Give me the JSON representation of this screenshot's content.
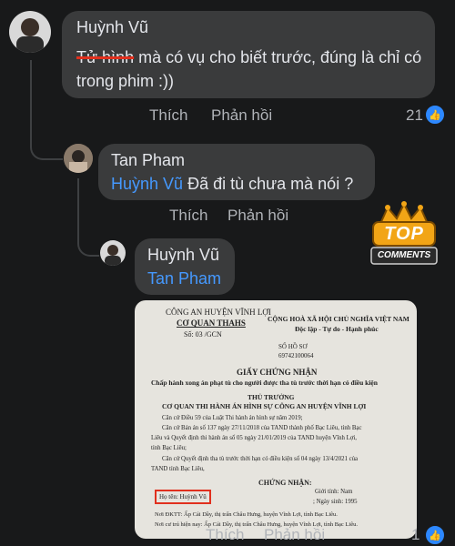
{
  "comments": [
    {
      "author": "Huỳnh Vũ",
      "text_struck": "Tử hình",
      "text_rest": " mà có vụ cho biết trước, đúng là chỉ có trong phim :))",
      "like_label": "Thích",
      "reply_label": "Phản hồi",
      "reaction_count": "21"
    },
    {
      "author": "Tan Pham",
      "mention": "Huỳnh Vũ",
      "text": " Đã đi tù chưa mà nói ?",
      "like_label": "Thích",
      "reply_label": "Phản hồi"
    },
    {
      "author": "Huỳnh Vũ",
      "mention": "Tan Pham",
      "like_label": "Thích",
      "reply_label": "Phản hồi",
      "reaction_count": "1"
    }
  ],
  "watermark": {
    "line1": "TOP",
    "line2": "COMMENTS"
  },
  "document": {
    "left_header_1": "CÔNG AN HUYỆN VĨNH LỢI",
    "left_header_2": "CƠ QUAN THAHS",
    "number": "Số: 03 /GCN",
    "right_header_1": "CỘNG HOÀ XÃ HỘI CHỦ NGHĨA VIỆT NAM",
    "right_header_2": "Độc lập - Tự do - Hạnh phúc",
    "file_no_label": "SỐ HỒ SƠ",
    "file_no": "69742100064",
    "title": "GIẤY CHỨNG NHẬN",
    "subtitle": "Chấp hành xong án phạt tù cho người được tha tù trước thời hạn có điều kiện",
    "authority_1": "THỦ TRƯỞNG",
    "authority_2": "CƠ QUAN THI HÀNH ÁN HÌNH SỰ CÔNG AN HUYỆN VĨNH LỢI",
    "line_1": "Căn cứ Điều 59 của Luật Thi hành án hình sự năm 2019;",
    "line_2": "Căn cứ Bản án số 137 ngày 27/11/2018 của TAND thành phố Bạc Liêu, tỉnh Bạc",
    "line_3": "Liêu và Quyết định thi hành án số 05 ngày 21/01/2019 của TAND huyện Vĩnh Lợi,",
    "line_4": "tỉnh Bạc Liêu;",
    "line_5": "Căn cứ Quyết định tha tù trước thời hạn có điều kiện số 04 ngày 13/4/2021 của",
    "line_6": "TAND tỉnh Bạc Liêu,",
    "certify": "CHỨNG NHẬN:",
    "name_field": "Họ tên: Huỳnh Vũ",
    "gender": "Giới tính: Nam",
    "dob": "; Ngày sinh: 1995",
    "line_7": "Nơi ĐKTT: Ấp Cái Dầy, thị trấn Châu Hưng, huyện Vĩnh Lợi, tỉnh Bạc Liêu.",
    "line_8": "Nơi cư trú hiện nay: Ấp Cái Dầy, thị trấn Châu Hưng, huyện Vĩnh Lợi, tỉnh Bạc Liêu."
  },
  "colors": {
    "background": "#18191a",
    "bubble": "#3a3b3c",
    "mention": "#4599ff",
    "highlight_box": "#e0301e"
  }
}
